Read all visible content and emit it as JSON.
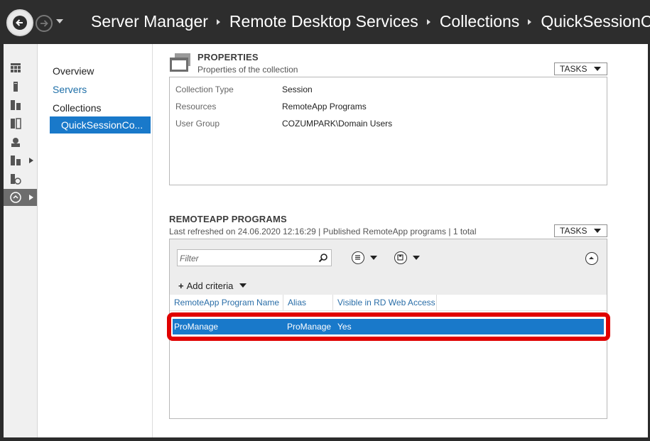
{
  "breadcrumb": [
    "Server Manager",
    "Remote Desktop Services",
    "Collections",
    "QuickSessionCollection"
  ],
  "nav": {
    "overview": "Overview",
    "servers": "Servers",
    "collections": "Collections",
    "selected_collection": "QuickSessionCo..."
  },
  "rail_icons": [
    "dashboard-icon",
    "local-server-icon",
    "all-servers-icon",
    "file-storage-icon",
    "iis-icon",
    "rds-icon",
    "wsus-icon",
    "remote-desktop-icon"
  ],
  "properties": {
    "title": "PROPERTIES",
    "subtitle": "Properties of the collection",
    "tasks_label": "TASKS",
    "rows": [
      {
        "label": "Collection Type",
        "value": "Session"
      },
      {
        "label": "Resources",
        "value": "RemoteApp Programs"
      },
      {
        "label": "User Group",
        "value": "COZUMPARK\\Domain Users"
      }
    ]
  },
  "remoteapp": {
    "title": "REMOTEAPP PROGRAMS",
    "subtitle": "Last refreshed on 24.06.2020 12:16:29 | Published RemoteApp programs  | 1 total",
    "tasks_label": "TASKS",
    "filter_placeholder": "Filter",
    "add_criteria": "Add criteria",
    "columns": [
      "RemoteApp Program Name",
      "Alias",
      "Visible in RD Web Access"
    ],
    "rows": [
      {
        "name": "ProManage",
        "alias": "ProManage",
        "visible": "Yes"
      }
    ]
  },
  "colors": {
    "accent": "#1979ca",
    "highlight": "#e00000",
    "titlebar": "#2d2d2d"
  }
}
